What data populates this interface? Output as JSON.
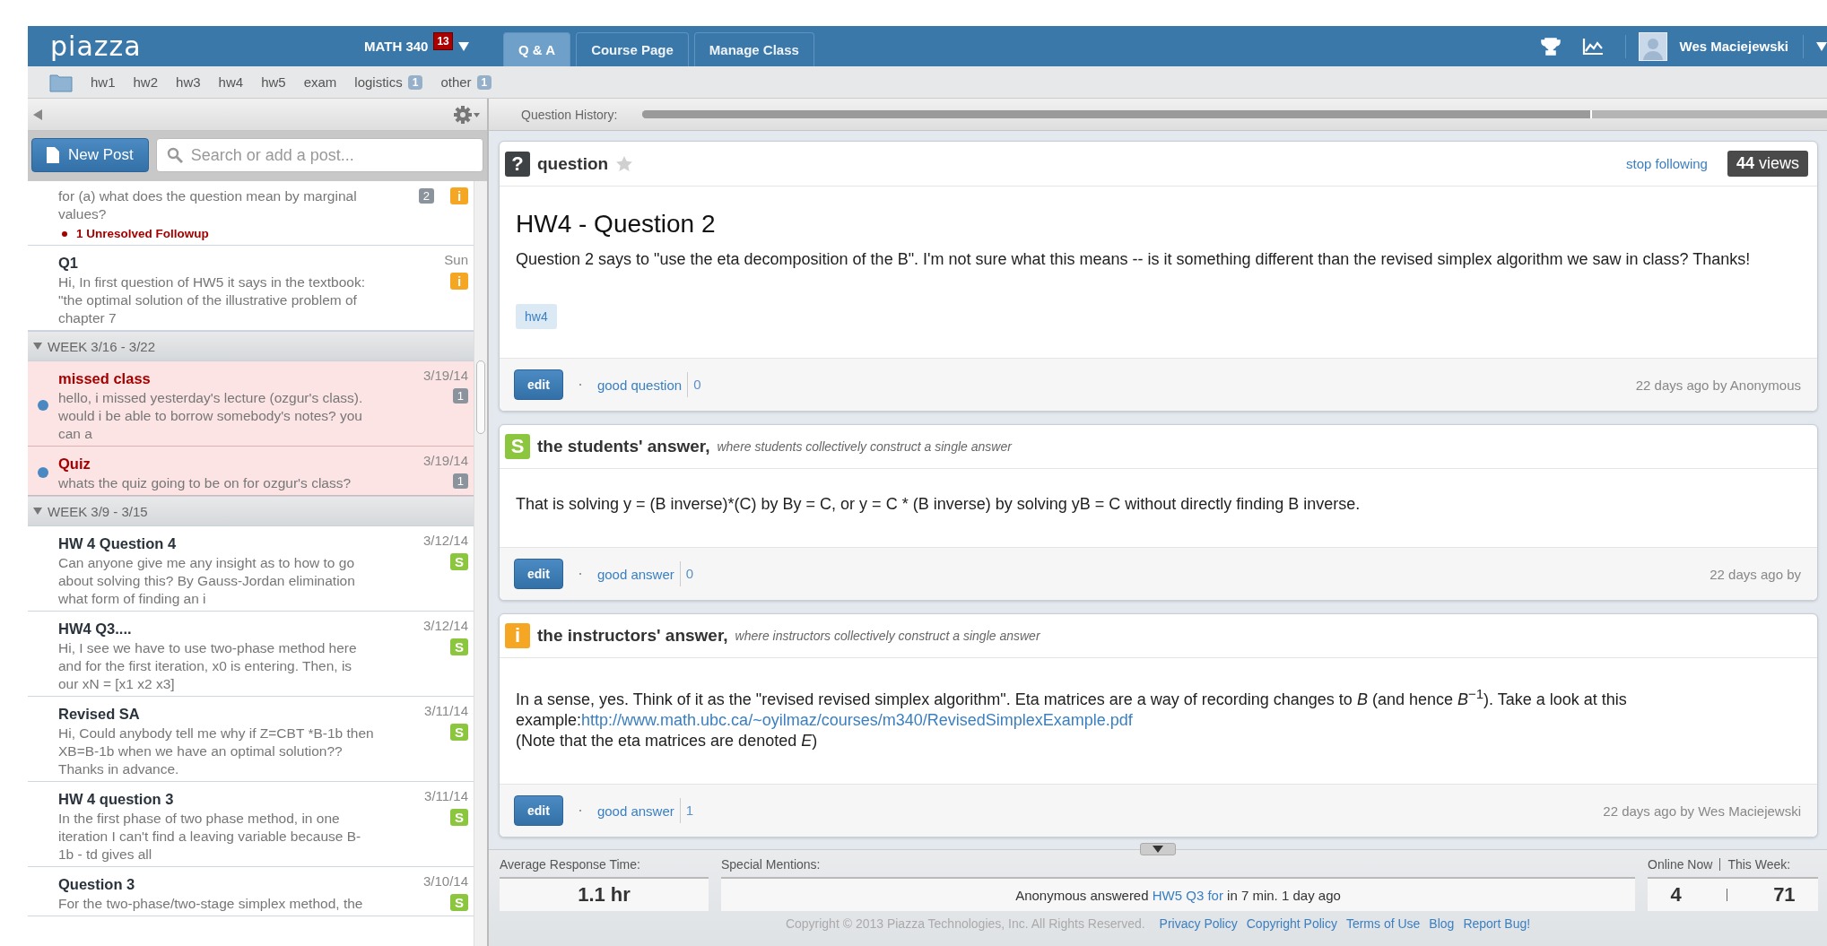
{
  "header": {
    "logo": "piazza",
    "course": "MATH 340",
    "notifications": "13",
    "tabs": [
      {
        "label": "Q & A",
        "selected": true
      },
      {
        "label": "Course Page",
        "selected": false
      },
      {
        "label": "Manage Class",
        "selected": false
      }
    ],
    "user": "Wes Maciejewski"
  },
  "folders": [
    {
      "label": "hw1"
    },
    {
      "label": "hw2"
    },
    {
      "label": "hw3"
    },
    {
      "label": "hw4"
    },
    {
      "label": "hw5"
    },
    {
      "label": "exam"
    },
    {
      "label": "logistics",
      "count": "1"
    },
    {
      "label": "other",
      "count": "1"
    }
  ],
  "new_post": "New Post",
  "search": {
    "placeholder": "Search or add a post..."
  },
  "feed": [
    {
      "posts": [
        {
          "snippet": "for (a) what does the question mean by marginal values?",
          "count": "2",
          "badge": {
            "kind": "instructor",
            "label": "i"
          },
          "followup": "1 Unresolved Followup",
          "unread": false
        },
        {
          "title": "Q1",
          "date": "Sun",
          "snippet": "Hi, In first question of HW5 it says in the textbook: \"the optimal solution of the illustrative problem of chapter 7",
          "badge": {
            "kind": "instructor",
            "label": "i"
          },
          "unread": false
        }
      ]
    },
    {
      "heading": "WEEK 3/16 - 3/22",
      "posts": [
        {
          "title": "missed class",
          "date": "3/19/14",
          "snippet": "hello,   i missed yesterday's lecture (ozgur's class). would i be able to borrow somebody's notes? you can a",
          "count": "1",
          "unread": true
        },
        {
          "title": "Quiz",
          "date": "3/19/14",
          "snippet": "whats the quiz going to be on for ozgur's class?",
          "count": "1",
          "unread": true
        }
      ]
    },
    {
      "heading": "WEEK 3/9 - 3/15",
      "posts": [
        {
          "title": "HW 4 Question 4",
          "date": "3/12/14",
          "snippet": "Can anyone give me any insight as to how to go about solving this? By Gauss-Jordan elimination what form of finding an i",
          "badge": {
            "kind": "student",
            "label": "S"
          },
          "unread": false
        },
        {
          "title": "HW4 Q3....",
          "date": "3/12/14",
          "snippet": "Hi, I see we have to use two-phase method here and for the first iteration, x0 is entering. Then, is our xN = [x1 x2 x3]",
          "badge": {
            "kind": "student",
            "label": "S"
          },
          "unread": false
        },
        {
          "title": "Revised SA",
          "date": "3/11/14",
          "snippet": "Hi, Could anybody tell me why if Z=CBT *B-1b then XB=B-1b when we have an optimal solution?? Thanks in advance.",
          "badge": {
            "kind": "student",
            "label": "S"
          },
          "unread": false
        },
        {
          "title": "HW 4 question 3",
          "date": "3/11/14",
          "snippet": "In the first phase of two phase method, in one iteration I can't find a leaving variable because B-1b - td gives all",
          "badge": {
            "kind": "student",
            "label": "S"
          },
          "unread": false
        },
        {
          "title": "Question 3",
          "date": "3/10/14",
          "snippet": "For the two-phase/two-stage simplex method, the",
          "badge": {
            "kind": "student",
            "label": "S"
          },
          "unread": false
        }
      ]
    }
  ],
  "history": {
    "label": "Question History:",
    "level": 0.8
  },
  "question": {
    "icon": "?",
    "type": "question",
    "starred": false,
    "follow": "stop following",
    "views": "**44** views",
    "title": "HW4 - Question 2",
    "body": "Question 2 says to \"use the eta decomposition of the B\".  I'm not sure what this means -- is it something different than the revised simplex algorithm we saw in class? Thanks!",
    "tags": [
      "hw4"
    ],
    "edit": "edit",
    "vote": "good question",
    "votes": "0",
    "meta": "22 days ago by Anonymous"
  },
  "answers": [
    {
      "kind": "student",
      "icon": "S",
      "heading": "the students' answer,",
      "subtitle": "where students collectively construct a single answer",
      "paragraphs": [
        {
          "text": "That is solving y = (B inverse)*(C) by By = C, or y = C * (B inverse) by solving yB = C without directly finding B inverse."
        }
      ],
      "edit": "edit",
      "vote": "good answer",
      "votes": "0",
      "meta": "22 days ago by"
    },
    {
      "kind": "instructor",
      "icon": "i",
      "heading": "the instructors' answer,",
      "subtitle": "where instructors collectively construct a single answer",
      "paragraphs": [
        {
          "text": "In a sense, yes. Think of it as the \"revised revised simplex algorithm\". Eta matrices are a way of recording changes to *B* (and hence *B*$^{−1}$). Take a look at this example:",
          "link": "http://www.math.ubc.ca/~oyilmaz/courses/m340/RevisedSimplexExample.pdf"
        },
        {
          "text": "(Note that the eta matrices are denoted *E*)"
        }
      ],
      "edit": "edit",
      "vote": "good answer",
      "votes": "1",
      "meta": "22 days ago by Wes Maciejewski"
    }
  ],
  "stats": {
    "avg_label": "Average Response Time:",
    "avg": "1.1 hr",
    "mentions_label": "Special Mentions:",
    "mention": {
      "before": "Anonymous answered",
      "link": "HW5 Q3 for",
      "after": "in 7 min. 1 day ago"
    },
    "online_label": "Online Now",
    "week_label": "This Week:",
    "online": "4",
    "week": "71"
  },
  "footer": {
    "copyright": "Copyright © 2013 Piazza Technologies, Inc. All Rights Reserved.",
    "links": [
      "Privacy Policy",
      "Copyright Policy",
      "Terms of Use",
      "Blog",
      "Report Bug!"
    ]
  }
}
